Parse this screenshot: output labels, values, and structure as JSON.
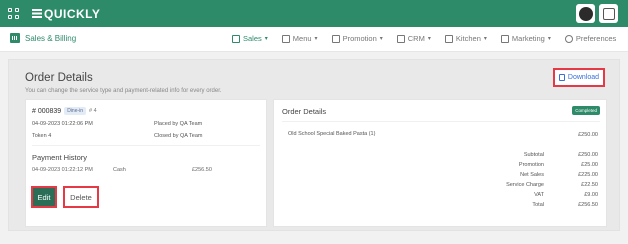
{
  "topbar": {
    "logo_text": "QUICKLY",
    "bg_color": "#2e8b6a"
  },
  "subnav": {
    "section_label": "Sales & Billing",
    "menu": [
      {
        "label": "Sales",
        "caret": "▾",
        "active": true,
        "icon": "sales-icon"
      },
      {
        "label": "Menu",
        "caret": "▾",
        "active": false,
        "icon": "menu-icon"
      },
      {
        "label": "Promotion",
        "caret": "▾",
        "active": false,
        "icon": "promotion-icon"
      },
      {
        "label": "CRM",
        "caret": "▾",
        "active": false,
        "icon": "crm-icon"
      },
      {
        "label": "Kitchen",
        "caret": "▾",
        "active": false,
        "icon": "kitchen-icon"
      },
      {
        "label": "Marketing",
        "caret": "▾",
        "active": false,
        "icon": "marketing-icon"
      },
      {
        "label": "Preferences",
        "caret": "",
        "active": false,
        "icon": "gear-icon"
      }
    ]
  },
  "page": {
    "title": "Order Details",
    "subtitle": "You can change the service type and payment-related info for every order.",
    "download_label": "Download"
  },
  "order": {
    "number": "# 000839",
    "type_badge": "Dine-in",
    "table": "# 4",
    "placed_date": "04-09-2023 01:22:06 PM",
    "placed_by": "Placed by QA Team",
    "token": "Token 4",
    "closed_by": "Closed by QA Team"
  },
  "payment_history": {
    "title": "Payment History",
    "date": "04-09-2023 01:22:12 PM",
    "method": "Cash",
    "amount": "£256.50"
  },
  "actions": {
    "edit_label": "Edit",
    "delete_label": "Delete"
  },
  "order_details": {
    "title": "Order Details",
    "status": "Completed",
    "item_name": "Old School Special Baked Pasta (1)",
    "item_price": "£250.00",
    "summary": [
      {
        "label": "Subtotal",
        "value": "£250.00"
      },
      {
        "label": "Promotion",
        "value": "£25.00"
      },
      {
        "label": "Net Sales",
        "value": "£225.00"
      },
      {
        "label": "Service Charge",
        "value": "£22.50"
      },
      {
        "label": "VAT",
        "value": "£9.00"
      },
      {
        "label": "Total",
        "value": "£256.50"
      }
    ]
  },
  "colors": {
    "accent": "#2e8b6a",
    "highlight_border": "#e53945",
    "link_blue": "#3a6fd8"
  }
}
